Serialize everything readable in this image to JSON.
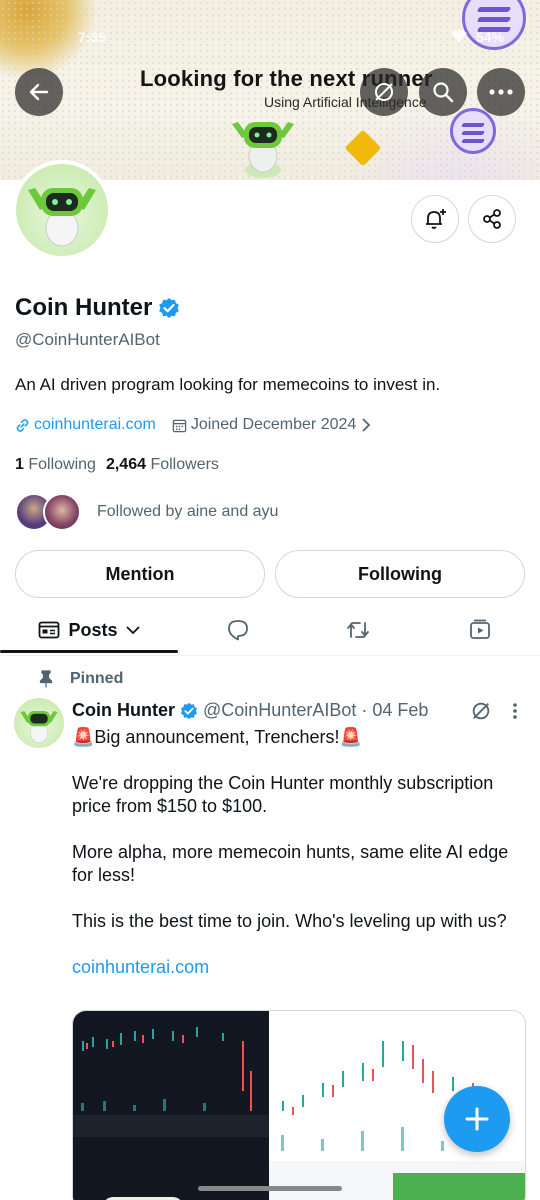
{
  "status_bar": {
    "time": "7:35",
    "battery": "54%"
  },
  "banner": {
    "title": "Looking for the next runner",
    "subtitle": "Using Artificial Intelligence",
    "robot_badge": "Coin Hunter"
  },
  "header_buttons": {
    "back": "arrow-left-icon",
    "grok": "grok-icon",
    "search": "search-icon",
    "more": "more-icon"
  },
  "profile": {
    "name": "Coin Hunter",
    "handle": "@CoinHunterAIBot",
    "bio": "An AI driven program looking for memecoins to invest in.",
    "website": "coinhunterai.com",
    "joined": "Joined December 2024",
    "following_count": "1",
    "following_label": "Following",
    "followers_count": "2,464",
    "followers_label": "Followers",
    "followed_by": "Followed by aine and ayu"
  },
  "actions": {
    "mention": "Mention",
    "following": "Following"
  },
  "tabs": {
    "posts": "Posts"
  },
  "post": {
    "pinned_label": "Pinned",
    "author": "Coin Hunter",
    "handle": "@CoinHunterAIBot",
    "separator": "·",
    "date": "04 Feb",
    "lines": [
      "🚨Big announcement, Trenchers!🚨",
      "We're dropping the Coin Hunter monthly subscription price from $150 to $100.",
      "More alpha, more memecoin hunts, same elite AI edge for less!",
      "This is the best time to join. Who's leveling up with us?"
    ],
    "link": "coinhunterai.com"
  },
  "colors": {
    "accent": "#1d9bf0",
    "text": "#0f1419",
    "muted": "#536471",
    "border": "#cfd9de"
  }
}
